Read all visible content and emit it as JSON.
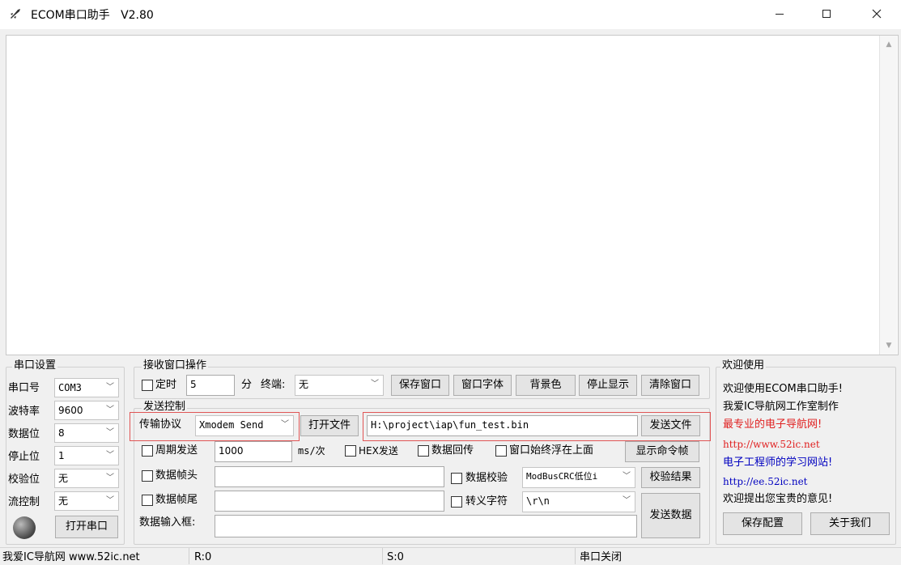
{
  "window": {
    "title": "ECOM串口助手   V2.80",
    "min_symbol": "—",
    "max_symbol": "☐",
    "close_symbol": "✕",
    "icons": {
      "app": "rocket-icon",
      "minimize": "minimize-icon",
      "maximize": "maximize-icon",
      "close": "close-icon"
    }
  },
  "serial_settings": {
    "legend": "串口设置",
    "port_label": "串口号",
    "port_value": "COM3",
    "baud_label": "波特率",
    "baud_value": "9600",
    "databits_label": "数据位",
    "databits_value": "8",
    "stopbits_label": "停止位",
    "stopbits_value": "1",
    "parity_label": "校验位",
    "parity_value": "无",
    "flow_label": "流控制",
    "flow_value": "无",
    "open_button": "打开串口",
    "status_led_color": "#555555"
  },
  "receive_ops": {
    "legend": "接收窗口操作",
    "timer_label": "定时",
    "timer_value": "5",
    "timer_unit": "分",
    "terminal_label": "终端:",
    "terminal_value": "无",
    "save_window": "保存窗口",
    "window_font": "窗口字体",
    "bg_color": "背景色",
    "stop_display": "停止显示",
    "clear_window": "清除窗口"
  },
  "send_control": {
    "legend": "发送控制",
    "protocol_label": "传输协议",
    "protocol_value": "Xmodem Send",
    "open_file": "打开文件",
    "file_path": "H:\\project\\iap\\fun_test.bin",
    "send_file": "发送文件",
    "periodic_label": "周期发送",
    "periodic_value": "1000",
    "periodic_unit": "ms/次",
    "hex_send": "HEX发送",
    "data_echo": "数据回传",
    "always_on_top": "窗口始终浮在上面",
    "show_cmd_frame": "显示命令帧",
    "frame_head": "数据帧头",
    "data_check": "数据校验",
    "check_value": "ModBusCRC低位i",
    "check_result": "校验结果",
    "frame_tail": "数据帧尾",
    "escape_chars": "转义字符",
    "escape_value": "\\r\\n",
    "input_label": "数据输入框:",
    "send_data": "发送数据"
  },
  "welcome": {
    "legend": "欢迎使用",
    "line1": "欢迎使用ECOM串口助手!",
    "line2": "我爱IC导航网工作室制作",
    "line3": "最专业的电子导航网!",
    "line4": "http://www.52ic.net",
    "line5": "电子工程师的学习网站!",
    "line6": "http://ee.52ic.net",
    "line7": "欢迎提出您宝贵的意见!",
    "save_config": "保存配置",
    "about_us": "关于我们",
    "red_color": "#e02020",
    "blue_color": "#0000c0"
  },
  "statusbar": {
    "site": "我爱IC导航网 www.52ic.net",
    "rx": "R:0",
    "tx": "S:0",
    "port_state": "串口关闭"
  }
}
